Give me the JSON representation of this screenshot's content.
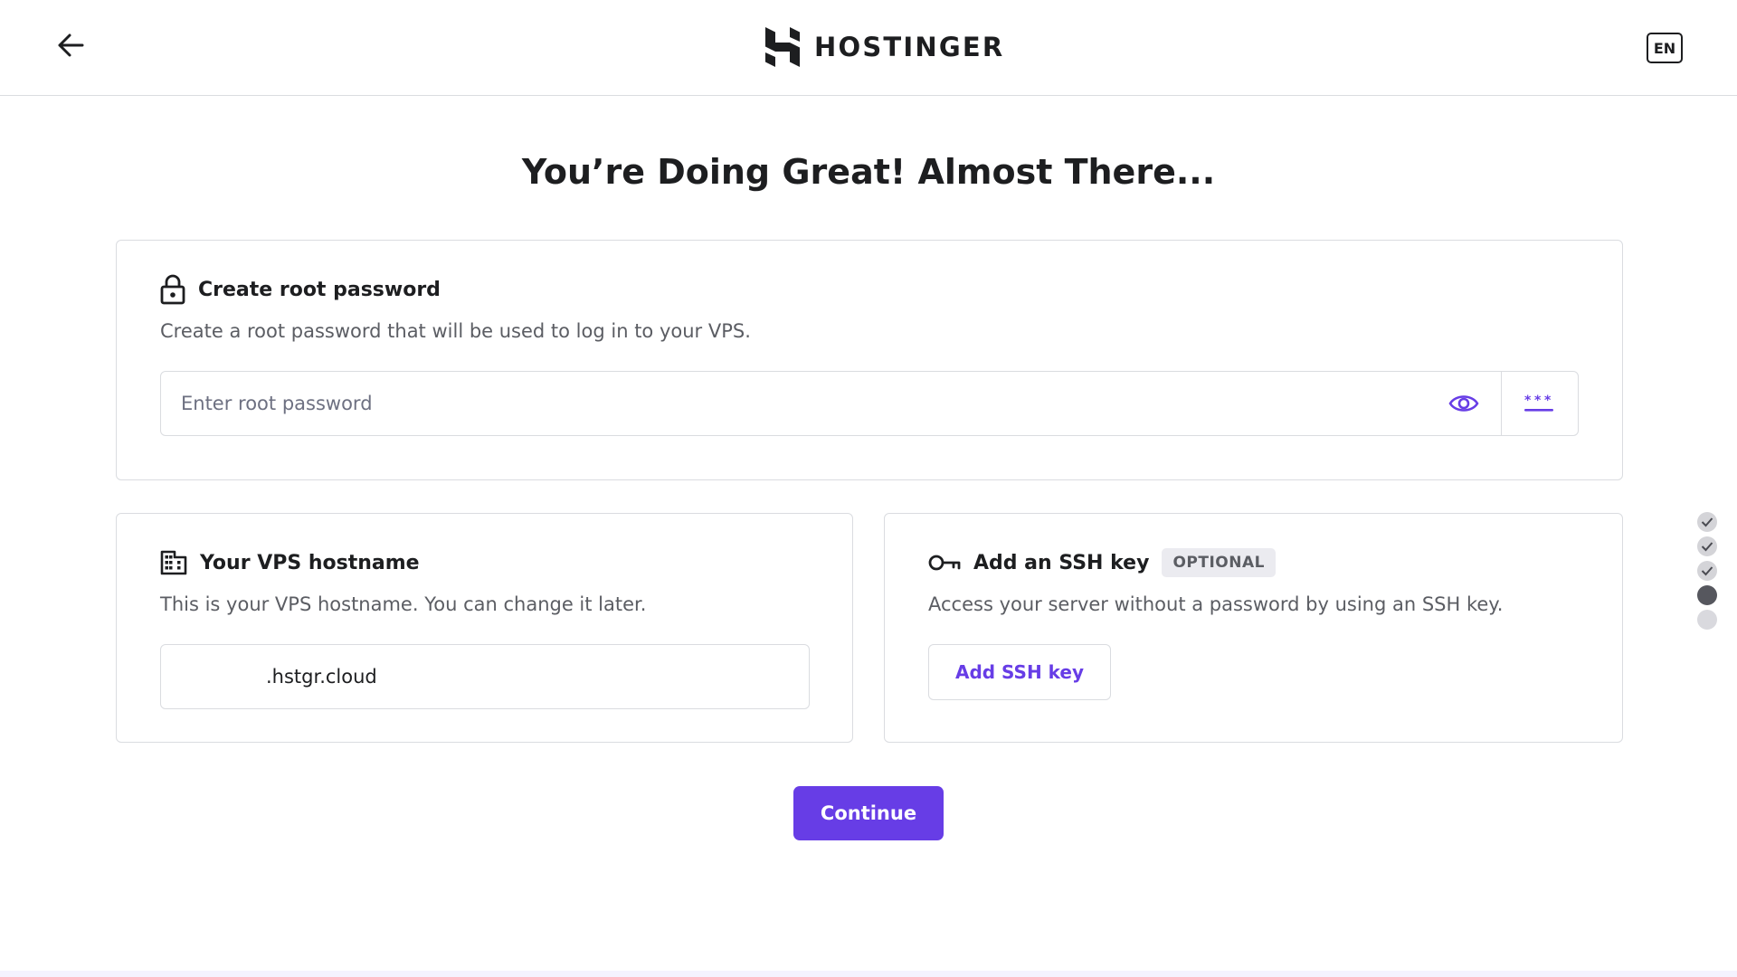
{
  "header": {
    "logo_text": "HOSTINGER",
    "language": "EN"
  },
  "page": {
    "title": "You’re Doing Great! Almost There..."
  },
  "root_password": {
    "title": "Create root password",
    "description": "Create a root password that will be used to log in to your VPS.",
    "placeholder": "Enter root password",
    "value": ""
  },
  "hostname": {
    "title": "Your VPS hostname",
    "description": "This is your VPS hostname. You can change it later.",
    "value": "",
    "suffix": ".hstgr.cloud"
  },
  "ssh": {
    "title": "Add an SSH key",
    "badge": "OPTIONAL",
    "description": "Access your server without a password by using an SSH key.",
    "button_label": "Add SSH key"
  },
  "actions": {
    "continue_label": "Continue"
  },
  "progress": {
    "total_steps": 5,
    "completed_steps": 3,
    "current_step": 4
  },
  "colors": {
    "accent": "#673de6",
    "text": "#1d1e20",
    "muted": "#5b5d63",
    "border": "#dadce0"
  }
}
